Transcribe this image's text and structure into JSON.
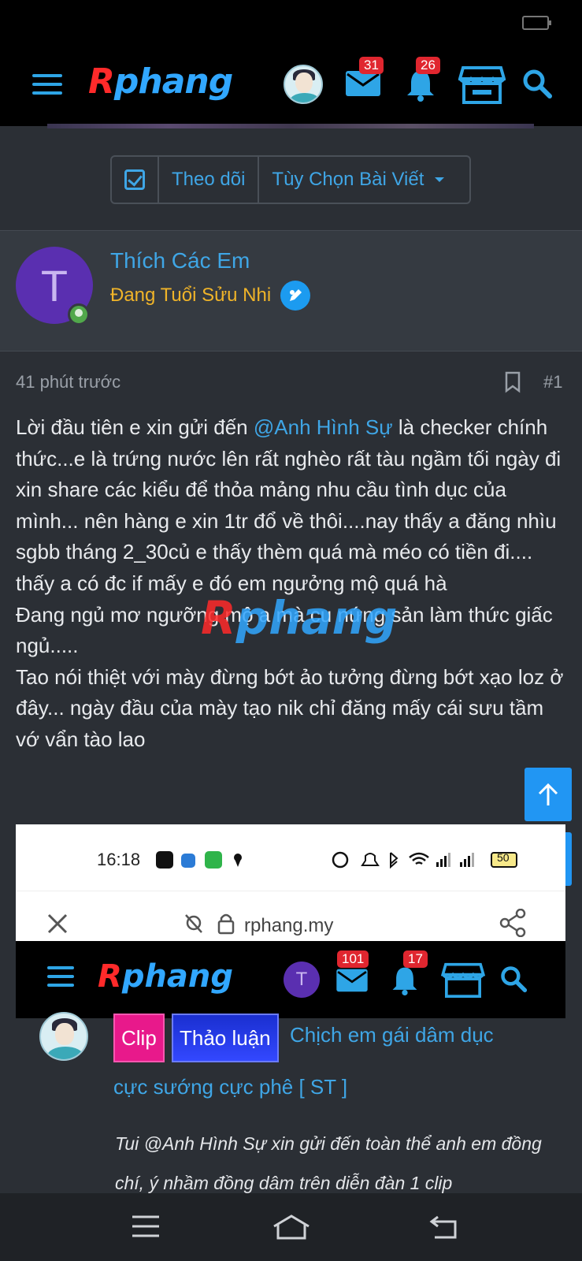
{
  "app": {
    "logo_r": "R",
    "logo_rest": "phang",
    "messages_count": "31",
    "notifications_count": "26"
  },
  "follow_bar": {
    "follow_label": "Theo dõi",
    "options_label": "Tùy Chọn Bài Viết"
  },
  "author": {
    "avatar_letter": "T",
    "name": "Thích Các Em",
    "title": "Đang Tuổi Sửu Nhi"
  },
  "post": {
    "time": "41 phút trước",
    "number": "#1",
    "intro": "Lời đầu tiên e xin gửi đến ",
    "mention": "@Anh Hình Sự",
    "body": " là checker chính thức...e là trứng nước lên rất nghèo rất tàu ngầm tối ngày đi xin share các kiểu để thỏa mảng nhu cầu tình dục của mình... nên hàng e xin 1tr đổ về thôi....nay thấy a đăng nhìu sgbb tháng 2_30củ e thấy thèm quá mà méo có tiền đi.... thấy a có đc if mấy e đó em ngưởng mộ quá hà",
    "line2": "Đang ngủ mơ ngưỡng mộ a mà cu nứng sản làm thức giấc ngủ.....",
    "line3": "Tao nói thiệt với mày đừng bớt ảo tưởng đừng bớt xạo loz ở đây... ngày đầu của mày tạo nik chỉ đăng mấy cái sưu tầm vớ vẩn tào lao"
  },
  "watermark": {
    "r": "R",
    "rest": "phang"
  },
  "embedded": {
    "time": "16:18",
    "battery": "50",
    "url": "rphang.my",
    "avatar_letter": "T",
    "messages_count": "101",
    "notifications_count": "17"
  },
  "quoted": {
    "tag_clip": "Clip",
    "tag_thao_luan": "Thảo luận",
    "title_line1": "Chịch em gái dâm dục",
    "title_line2": "cực sướng cực phê [ ST ]",
    "text": "Tui @Anh Hình Sự xin gửi đến toàn thể anh em đồng chí, ý nhầm đồng dâm trên diễn đàn 1 clip"
  },
  "colors": {
    "accent": "#3fa6e6",
    "badge": "#e0262f",
    "user_title": "#f0b429",
    "scroll_button": "#2196f3"
  }
}
